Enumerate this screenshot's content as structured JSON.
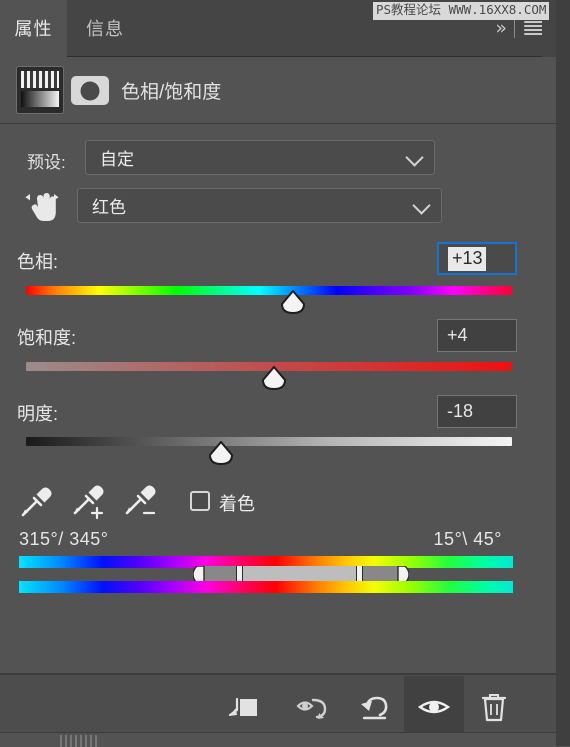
{
  "window": {
    "watermark": "PS教程论坛 WWW.16XX8.COM"
  },
  "tabs": [
    {
      "label": "属性",
      "active": true
    },
    {
      "label": "信息",
      "active": false
    }
  ],
  "tabbar_icons": {
    "collapse": "»",
    "menu": "hamburger-menu-icon"
  },
  "header": {
    "title": "色相/饱和度",
    "adjustment_icon": "hue-saturation-icon",
    "mask_thumbnail": "layer-mask-thumbnail"
  },
  "preset": {
    "label": "预设:",
    "value": "自定",
    "caret": "chevron-down-icon"
  },
  "channel": {
    "value": "红色",
    "caret": "chevron-down-icon",
    "targeted_adjust_icon": "on-image-adjustment-hand-icon"
  },
  "sliders": [
    {
      "name": "hue",
      "label": "色相:",
      "value": "+13",
      "focused": true
    },
    {
      "name": "saturation",
      "label": "饱和度:",
      "value": "+4",
      "focused": false
    },
    {
      "name": "lightness",
      "label": "明度:",
      "value": "-18",
      "focused": false
    }
  ],
  "tools": {
    "eyedropper": "eyedropper-icon",
    "eyedropper_add": "eyedropper-add-icon",
    "eyedropper_subtract": "eyedropper-subtract-icon"
  },
  "colorize": {
    "label": "着色",
    "checked": false
  },
  "color_range": {
    "left_degrees": "315°/ 345°",
    "right_degrees": "15°\\ 45°"
  },
  "footer": {
    "clip_to_layer": "clip-to-layer-icon",
    "preview_previous": "view-previous-state-icon",
    "reset": "reset-icon",
    "visibility": "toggle-layer-visibility-icon",
    "delete": "delete-adjustment-layer-icon"
  },
  "colors": {
    "panel_bg": "#535353",
    "tabbar_bg": "#454545",
    "footer_bg": "#4d4d4d",
    "focus_blue": "#1473d6",
    "text": "#e2e2e2"
  }
}
